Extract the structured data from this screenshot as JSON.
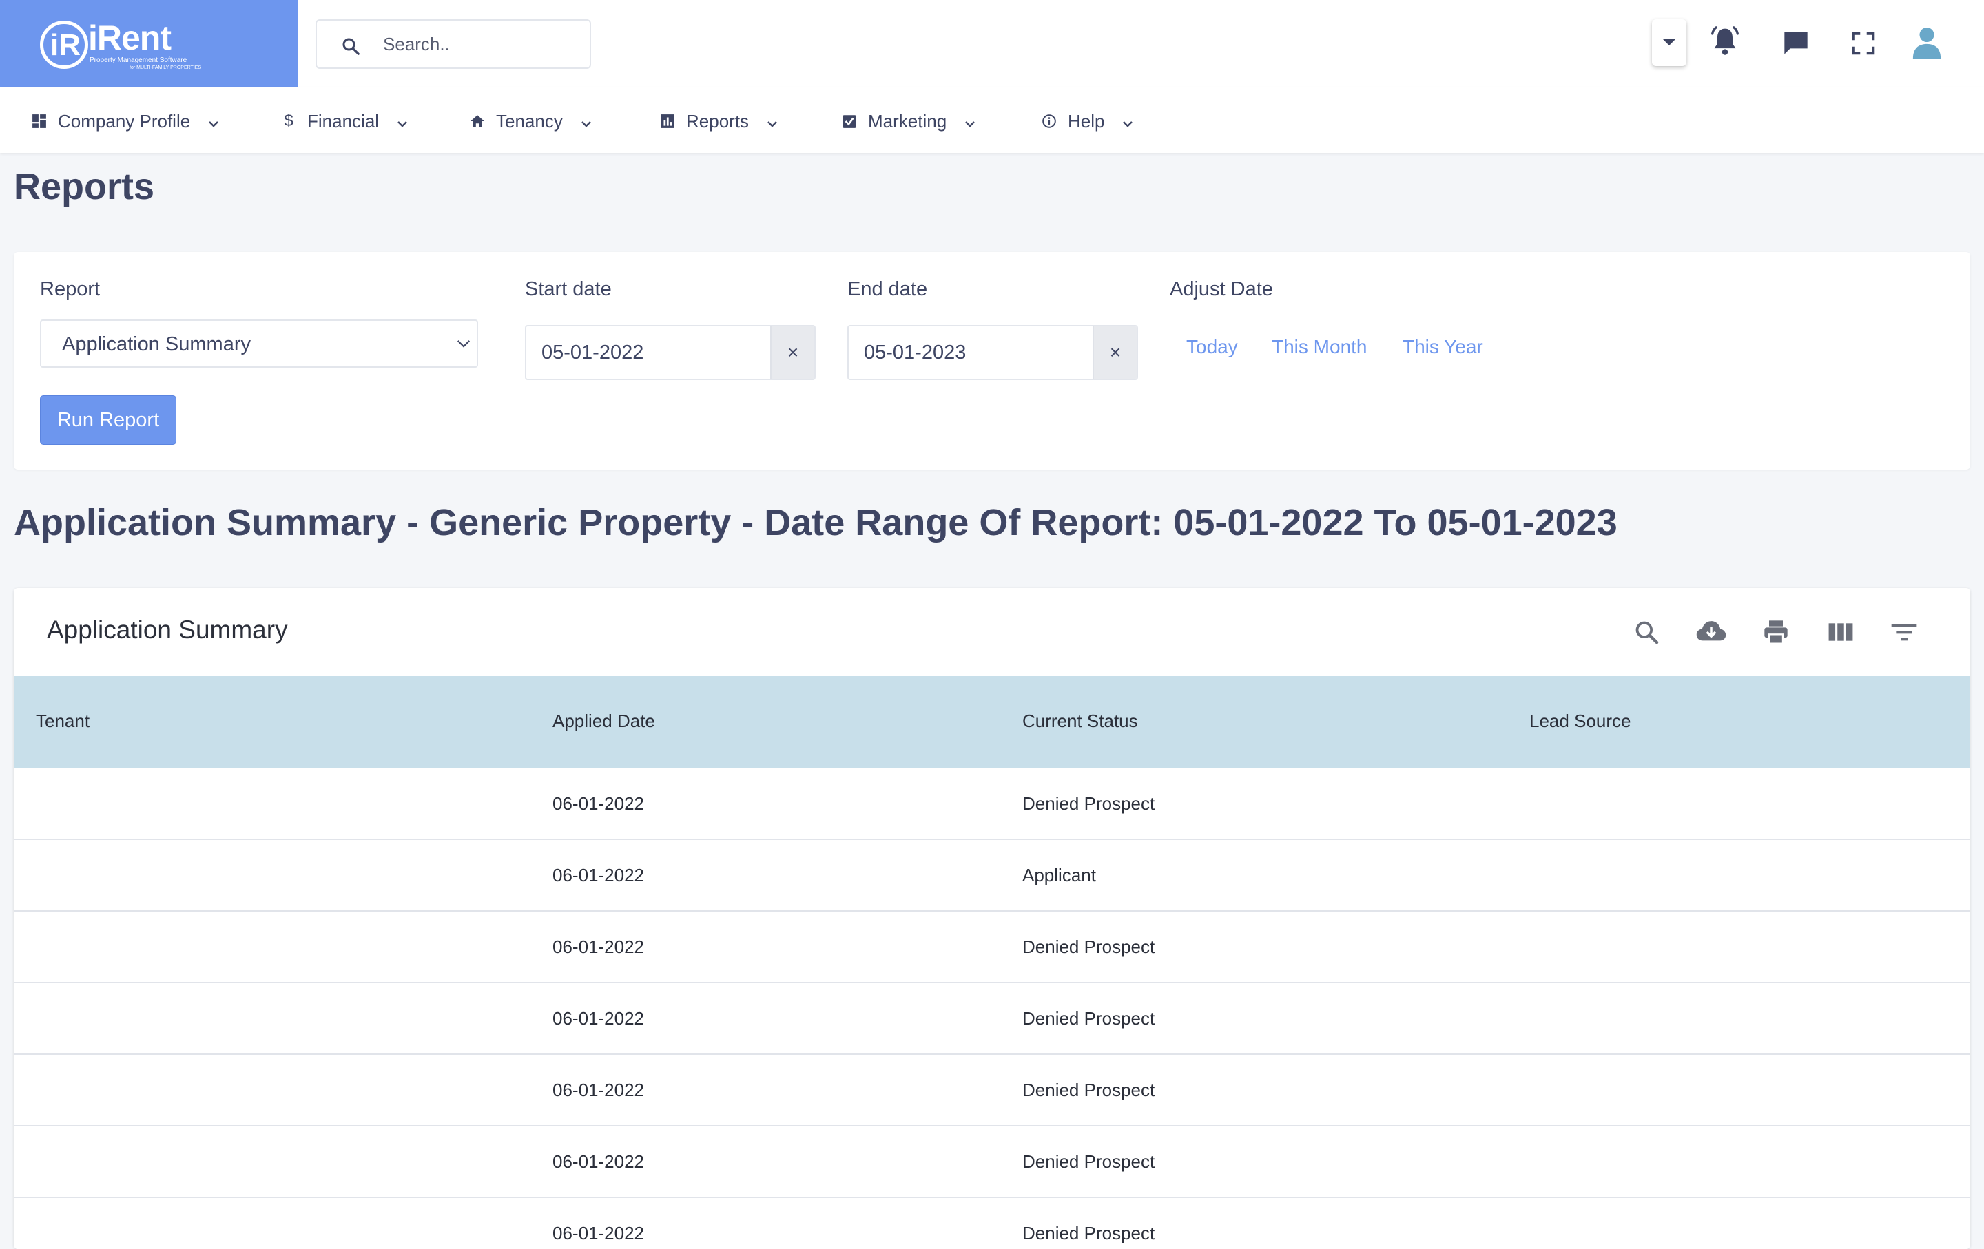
{
  "brand": {
    "logo_mark": "iR",
    "name": "iRent",
    "tagline": "Property Management Software",
    "tagline_sub": "for MULTI-FAMILY PROPERTIES",
    "color": "#6d96ee"
  },
  "search": {
    "placeholder": "Search.."
  },
  "header_icons": [
    "caret-down-icon",
    "bell-icon",
    "chat-icon",
    "fullscreen-icon",
    "user-icon"
  ],
  "nav": {
    "items": [
      {
        "label": "Company Profile",
        "icon": "dashboard-icon"
      },
      {
        "label": "Financial",
        "icon": "dollar-icon"
      },
      {
        "label": "Tenancy",
        "icon": "home-icon"
      },
      {
        "label": "Reports",
        "icon": "chart-icon"
      },
      {
        "label": "Marketing",
        "icon": "check-square-icon"
      },
      {
        "label": "Help",
        "icon": "info-icon"
      }
    ]
  },
  "page": {
    "title": "Reports"
  },
  "filters": {
    "report_label": "Report",
    "report_value": "Application Summary",
    "start_label": "Start date",
    "start_value": "05-01-2022",
    "end_label": "End date",
    "end_value": "05-01-2023",
    "clear_symbol": "×",
    "adjust_label": "Adjust Date",
    "quick": [
      "Today",
      "This Month",
      "This Year"
    ],
    "run_label": "Run Report"
  },
  "report_heading": "Application Summary - Generic Property - Date Range Of Report: 05-01-2022 To 05-01-2023",
  "table": {
    "title": "Application Summary",
    "tools": [
      "search-icon",
      "download-icon",
      "print-icon",
      "columns-icon",
      "filter-icon"
    ],
    "columns": [
      "Tenant",
      "Applied Date",
      "Current Status",
      "Lead Source"
    ],
    "rows": [
      {
        "tenant": "",
        "applied": "06-01-2022",
        "status": "Denied Prospect",
        "source": ""
      },
      {
        "tenant": "",
        "applied": "06-01-2022",
        "status": "Applicant",
        "source": ""
      },
      {
        "tenant": "",
        "applied": "06-01-2022",
        "status": "Denied Prospect",
        "source": ""
      },
      {
        "tenant": "",
        "applied": "06-01-2022",
        "status": "Denied Prospect",
        "source": ""
      },
      {
        "tenant": "",
        "applied": "06-01-2022",
        "status": "Denied Prospect",
        "source": ""
      },
      {
        "tenant": "",
        "applied": "06-01-2022",
        "status": "Denied Prospect",
        "source": ""
      },
      {
        "tenant": "",
        "applied": "06-01-2022",
        "status": "Denied Prospect",
        "source": ""
      }
    ]
  },
  "colors": {
    "accent": "#6d96ee",
    "header_row": "#c8dfea",
    "text": "#3e4563",
    "background": "#f4f6f9"
  }
}
